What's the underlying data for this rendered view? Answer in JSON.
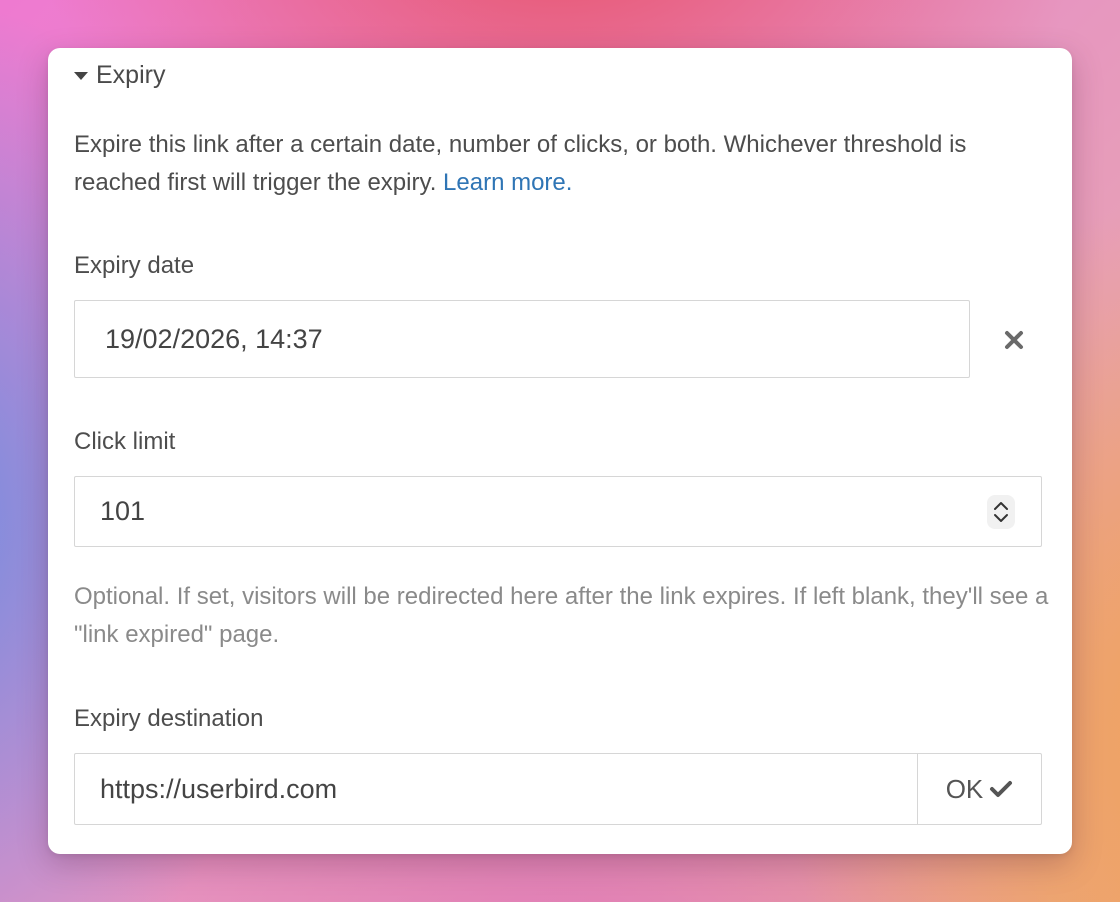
{
  "expiry": {
    "summary_label": "Expiry",
    "description": "Expire this link after a certain date, number of clicks, or both. Whichever threshold is reached first will trigger the expiry.",
    "learn_more_label": "Learn more.",
    "expiry_date_label": "Expiry date",
    "expiry_date_value": "19/02/2026, 14:37",
    "clear_icon": "close-x-icon",
    "click_limit_label": "Click limit",
    "click_limit_value": "101",
    "help_text": "Optional. If set, visitors will be redirected here after the link expires. If left blank, they'll see a \"link expired\" page.",
    "expiry_destination_label": "Expiry destination",
    "expiry_destination_value": "https://userbird.com",
    "ok_label": "OK",
    "ok_icon": "checkmark-icon"
  },
  "colors": {
    "link": "#2f75b5",
    "text": "#4d4d4d",
    "muted": "#8a8a8a",
    "border": "#d6d6d6"
  }
}
